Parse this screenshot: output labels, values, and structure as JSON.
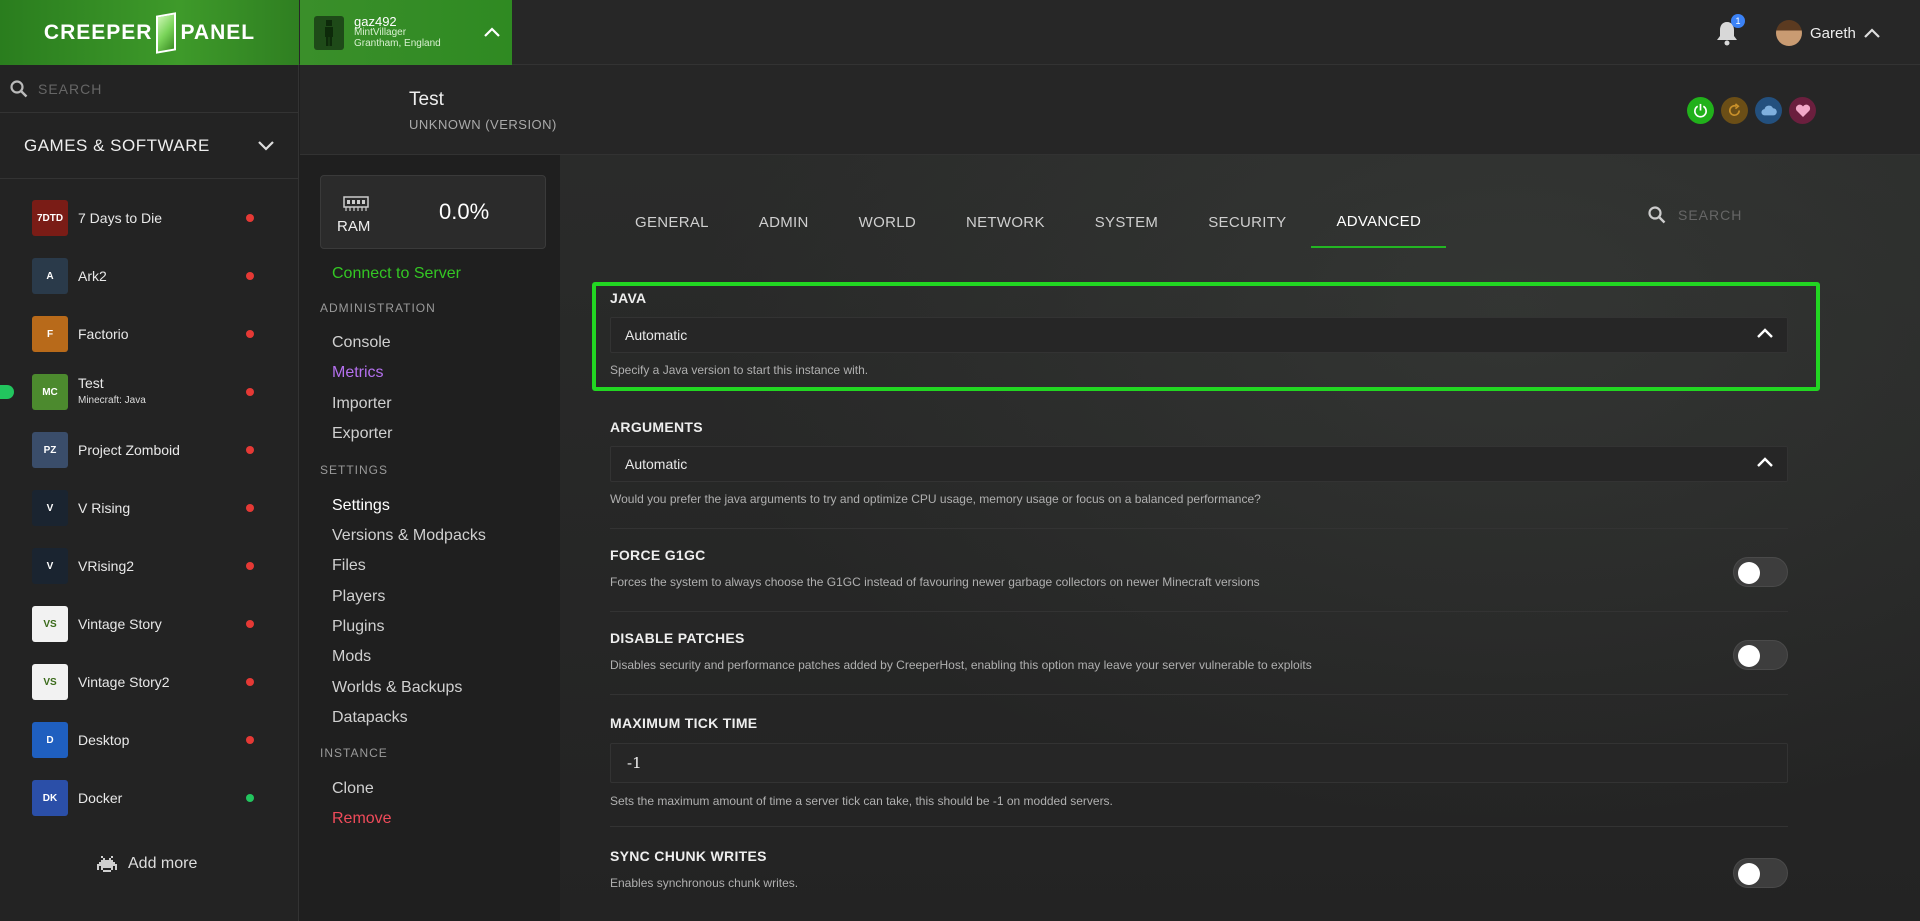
{
  "brand": {
    "left": "CREEPER",
    "right": "PANEL"
  },
  "user": {
    "name": "gaz492",
    "rank": "MintVillager",
    "location": "Grantham, England"
  },
  "notifications": {
    "count": "1"
  },
  "profile": {
    "name": "Gareth"
  },
  "sidebar": {
    "search_placeholder": "SEARCH",
    "category": "GAMES & SOFTWARE",
    "games": [
      {
        "name": "7 Days to Die",
        "sub": "",
        "status": "offline",
        "color": "#7a1c16",
        "abbr": "7DTD"
      },
      {
        "name": "Ark2",
        "sub": "",
        "status": "offline",
        "color": "#2a3a4a",
        "abbr": "A"
      },
      {
        "name": "Factorio",
        "sub": "",
        "status": "offline",
        "color": "#b86a1a",
        "abbr": "F"
      },
      {
        "name": "Test",
        "sub": "Minecraft: Java",
        "status": "offline",
        "color": "#4c8a2e",
        "abbr": "MC"
      },
      {
        "name": "Project Zomboid",
        "sub": "",
        "status": "offline",
        "color": "#3a4d6a",
        "abbr": "PZ"
      },
      {
        "name": "V Rising",
        "sub": "",
        "status": "offline",
        "color": "#1a2430",
        "abbr": "V"
      },
      {
        "name": "VRising2",
        "sub": "",
        "status": "offline",
        "color": "#1a2430",
        "abbr": "V"
      },
      {
        "name": "Vintage Story",
        "sub": "",
        "status": "offline",
        "color": "#f2f2f2",
        "abbr": "VS"
      },
      {
        "name": "Vintage Story2",
        "sub": "",
        "status": "offline",
        "color": "#f2f2f2",
        "abbr": "VS"
      },
      {
        "name": "Desktop",
        "sub": "",
        "status": "offline",
        "color": "#1f5fbf",
        "abbr": "D"
      },
      {
        "name": "Docker",
        "sub": "",
        "status": "online",
        "color": "#2b4fa8",
        "abbr": "DK"
      }
    ],
    "add_more": "Add more"
  },
  "instance": {
    "title": "Test",
    "version": "UNKNOWN (VERSION)"
  },
  "ram": {
    "label": "RAM",
    "value": "0.0%"
  },
  "nav": {
    "connect": "Connect to Server",
    "administration": "ADMINISTRATION",
    "console": "Console",
    "metrics": "Metrics",
    "importer": "Importer",
    "exporter": "Exporter",
    "settings_head": "SETTINGS",
    "settings": "Settings",
    "versions": "Versions & Modpacks",
    "files": "Files",
    "players": "Players",
    "plugins": "Plugins",
    "mods": "Mods",
    "worlds": "Worlds & Backups",
    "datapacks": "Datapacks",
    "instance_head": "INSTANCE",
    "clone": "Clone",
    "remove": "Remove"
  },
  "tabs": [
    "GENERAL",
    "ADMIN",
    "WORLD",
    "NETWORK",
    "SYSTEM",
    "SECURITY",
    "ADVANCED"
  ],
  "active_tab": "ADVANCED",
  "tab_search_placeholder": "SEARCH",
  "settings": {
    "java": {
      "title": "JAVA",
      "value": "Automatic",
      "desc": "Specify a Java version to start this instance with."
    },
    "arguments": {
      "title": "ARGUMENTS",
      "value": "Automatic",
      "desc": "Would you prefer the java arguments to try and optimize CPU usage, memory usage or focus on a balanced performance?"
    },
    "force_g1gc": {
      "title": "FORCE G1GC",
      "desc": "Forces the system to always choose the G1GC instead of favouring newer garbage collectors on newer Minecraft versions",
      "enabled": false
    },
    "disable_patches": {
      "title": "DISABLE PATCHES",
      "desc": "Disables security and performance patches added by CreeperHost, enabling this option may leave your server vulnerable to exploits",
      "enabled": false
    },
    "max_tick": {
      "title": "MAXIMUM TICK TIME",
      "value": "-1",
      "desc": "Sets the maximum amount of time a server tick can take, this should be -1 on modded servers."
    },
    "sync_chunk": {
      "title": "SYNC CHUNK WRITES",
      "desc": "Enables synchronous chunk writes.",
      "enabled": false
    }
  },
  "colors": {
    "accent": "#22c55e",
    "offline": "#e53935",
    "metrics": "#b470ee",
    "remove": "#ef4b5a"
  }
}
